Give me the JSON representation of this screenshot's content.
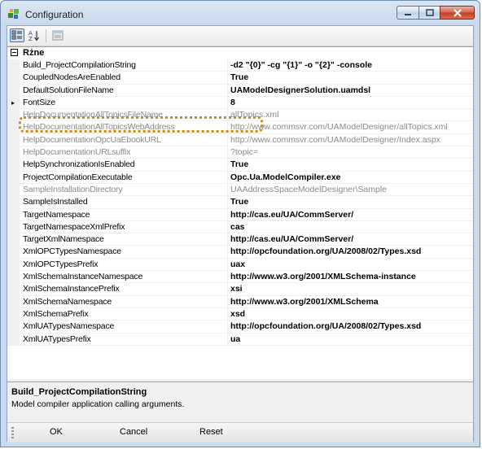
{
  "window": {
    "title": "Configuration"
  },
  "toolbar": {
    "categorized_icon": "categorized-icon",
    "alphabetical_icon": "sort-alphabetical-icon",
    "property_pages_icon": "property-pages-icon"
  },
  "grid": {
    "category": "Rżne",
    "rows": [
      {
        "name": "Build_ProjectCompilationString",
        "value": "-d2 \"{0}\"  -cg \"{1}\" -o \"{2}\" -console",
        "readonly": false
      },
      {
        "name": "CoupledNodesAreEnabled",
        "value": "True",
        "readonly": false
      },
      {
        "name": "DefaultSolutionFileName",
        "value": "UAModelDesignerSolution.uamdsl",
        "readonly": false
      },
      {
        "name": "FontSize",
        "value": "8",
        "readonly": false
      },
      {
        "name": "HelpDocumentationAllTopicsFileName",
        "value": "allTopics.xml",
        "readonly": true
      },
      {
        "name": "HelpDocumentationAllTopicsWebAddress",
        "value": "http://www.commsvr.com/UAModelDesigner/allTopics.xml",
        "readonly": true
      },
      {
        "name": "HelpDocumentationOpcUaEbookURL",
        "value": "http://www.commsvr.com/UAModelDesigner/Index.aspx",
        "readonly": true
      },
      {
        "name": "HelpDocumentationURLsuffix",
        "value": "?topic=",
        "readonly": true
      },
      {
        "name": "HelpSynchronizationIsEnabled",
        "value": "True",
        "readonly": false
      },
      {
        "name": "ProjectCompilationExecutable",
        "value": "Opc.Ua.ModelCompiler.exe",
        "readonly": false
      },
      {
        "name": "SampleInstallationDirectory",
        "value": "UAAddressSpaceModelDesigner\\Sample",
        "readonly": true
      },
      {
        "name": "SampleIsInstalled",
        "value": "True",
        "readonly": false
      },
      {
        "name": "TargetNamespace",
        "value": "http://cas.eu/UA/CommServer/",
        "readonly": false
      },
      {
        "name": "TargetNamespaceXmlPrefix",
        "value": "cas",
        "readonly": false
      },
      {
        "name": "TargetXmlNamespace",
        "value": "http://cas.eu/UA/CommServer/",
        "readonly": false
      },
      {
        "name": "XmlOPCTypesNamespace",
        "value": "http://opcfoundation.org/UA/2008/02/Types.xsd",
        "readonly": false
      },
      {
        "name": "XmlOPCTypesPrefix",
        "value": "uax",
        "readonly": false
      },
      {
        "name": "XmlSchemaInstanceNamespace",
        "value": "http://www.w3.org/2001/XMLSchema-instance",
        "readonly": false
      },
      {
        "name": "XmlSchemaInstancePrefix",
        "value": "xsi",
        "readonly": false
      },
      {
        "name": "XmlSchemaNamespace",
        "value": "http://www.w3.org/2001/XMLSchema",
        "readonly": false
      },
      {
        "name": "XmlSchemaPrefix",
        "value": "xsd",
        "readonly": false
      },
      {
        "name": "XmlUATypesNamespace",
        "value": "http://opcfoundation.org/UA/2008/02/Types.xsd",
        "readonly": false
      },
      {
        "name": "XmlUATypesPrefix",
        "value": "ua",
        "readonly": false
      }
    ]
  },
  "help": {
    "title": "Build_ProjectCompilationString",
    "description": "Model compiler application calling arguments."
  },
  "buttons": {
    "ok": "OK",
    "cancel": "Cancel",
    "reset": "Reset"
  },
  "colors": {
    "highlight": "#d08a1a",
    "readonly_text": "#8a8a8a"
  }
}
